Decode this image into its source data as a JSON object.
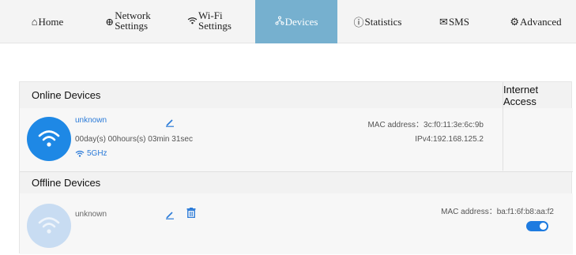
{
  "nav": {
    "home": "Home",
    "network_l1": "Network",
    "network_l2": "Settings",
    "wifi_l1": "Wi-Fi",
    "wifi_l2": "Settings",
    "devices": "Devices",
    "statistics": "Statistics",
    "sms": "SMS",
    "advanced": "Advanced",
    "active_tab": "devices"
  },
  "online": {
    "header": "Online Devices",
    "internet_access_header": "Internet Access",
    "device": {
      "name": "unknown",
      "uptime": "00day(s) 00hours(s) 03min 31sec",
      "band": "5GHz",
      "mac": "MAC address：3c:f0:11:3e:6c:9b",
      "ip": "IPv4:192.168.125.2"
    }
  },
  "offline": {
    "header": "Offline Devices",
    "device": {
      "name": "unknown",
      "mac": "MAC address：ba:f1:6f:b8:aa:f2",
      "internet_access": true
    }
  },
  "colors": {
    "accent": "#1e88e5",
    "active_tab": "#76b0cf",
    "link": "#2a7ad8"
  },
  "icons": [
    "home-icon",
    "globe-icon",
    "wifi-icon",
    "devices-icon",
    "statistics-icon",
    "envelope-icon",
    "gear-icon",
    "edit-icon",
    "trash-icon"
  ]
}
